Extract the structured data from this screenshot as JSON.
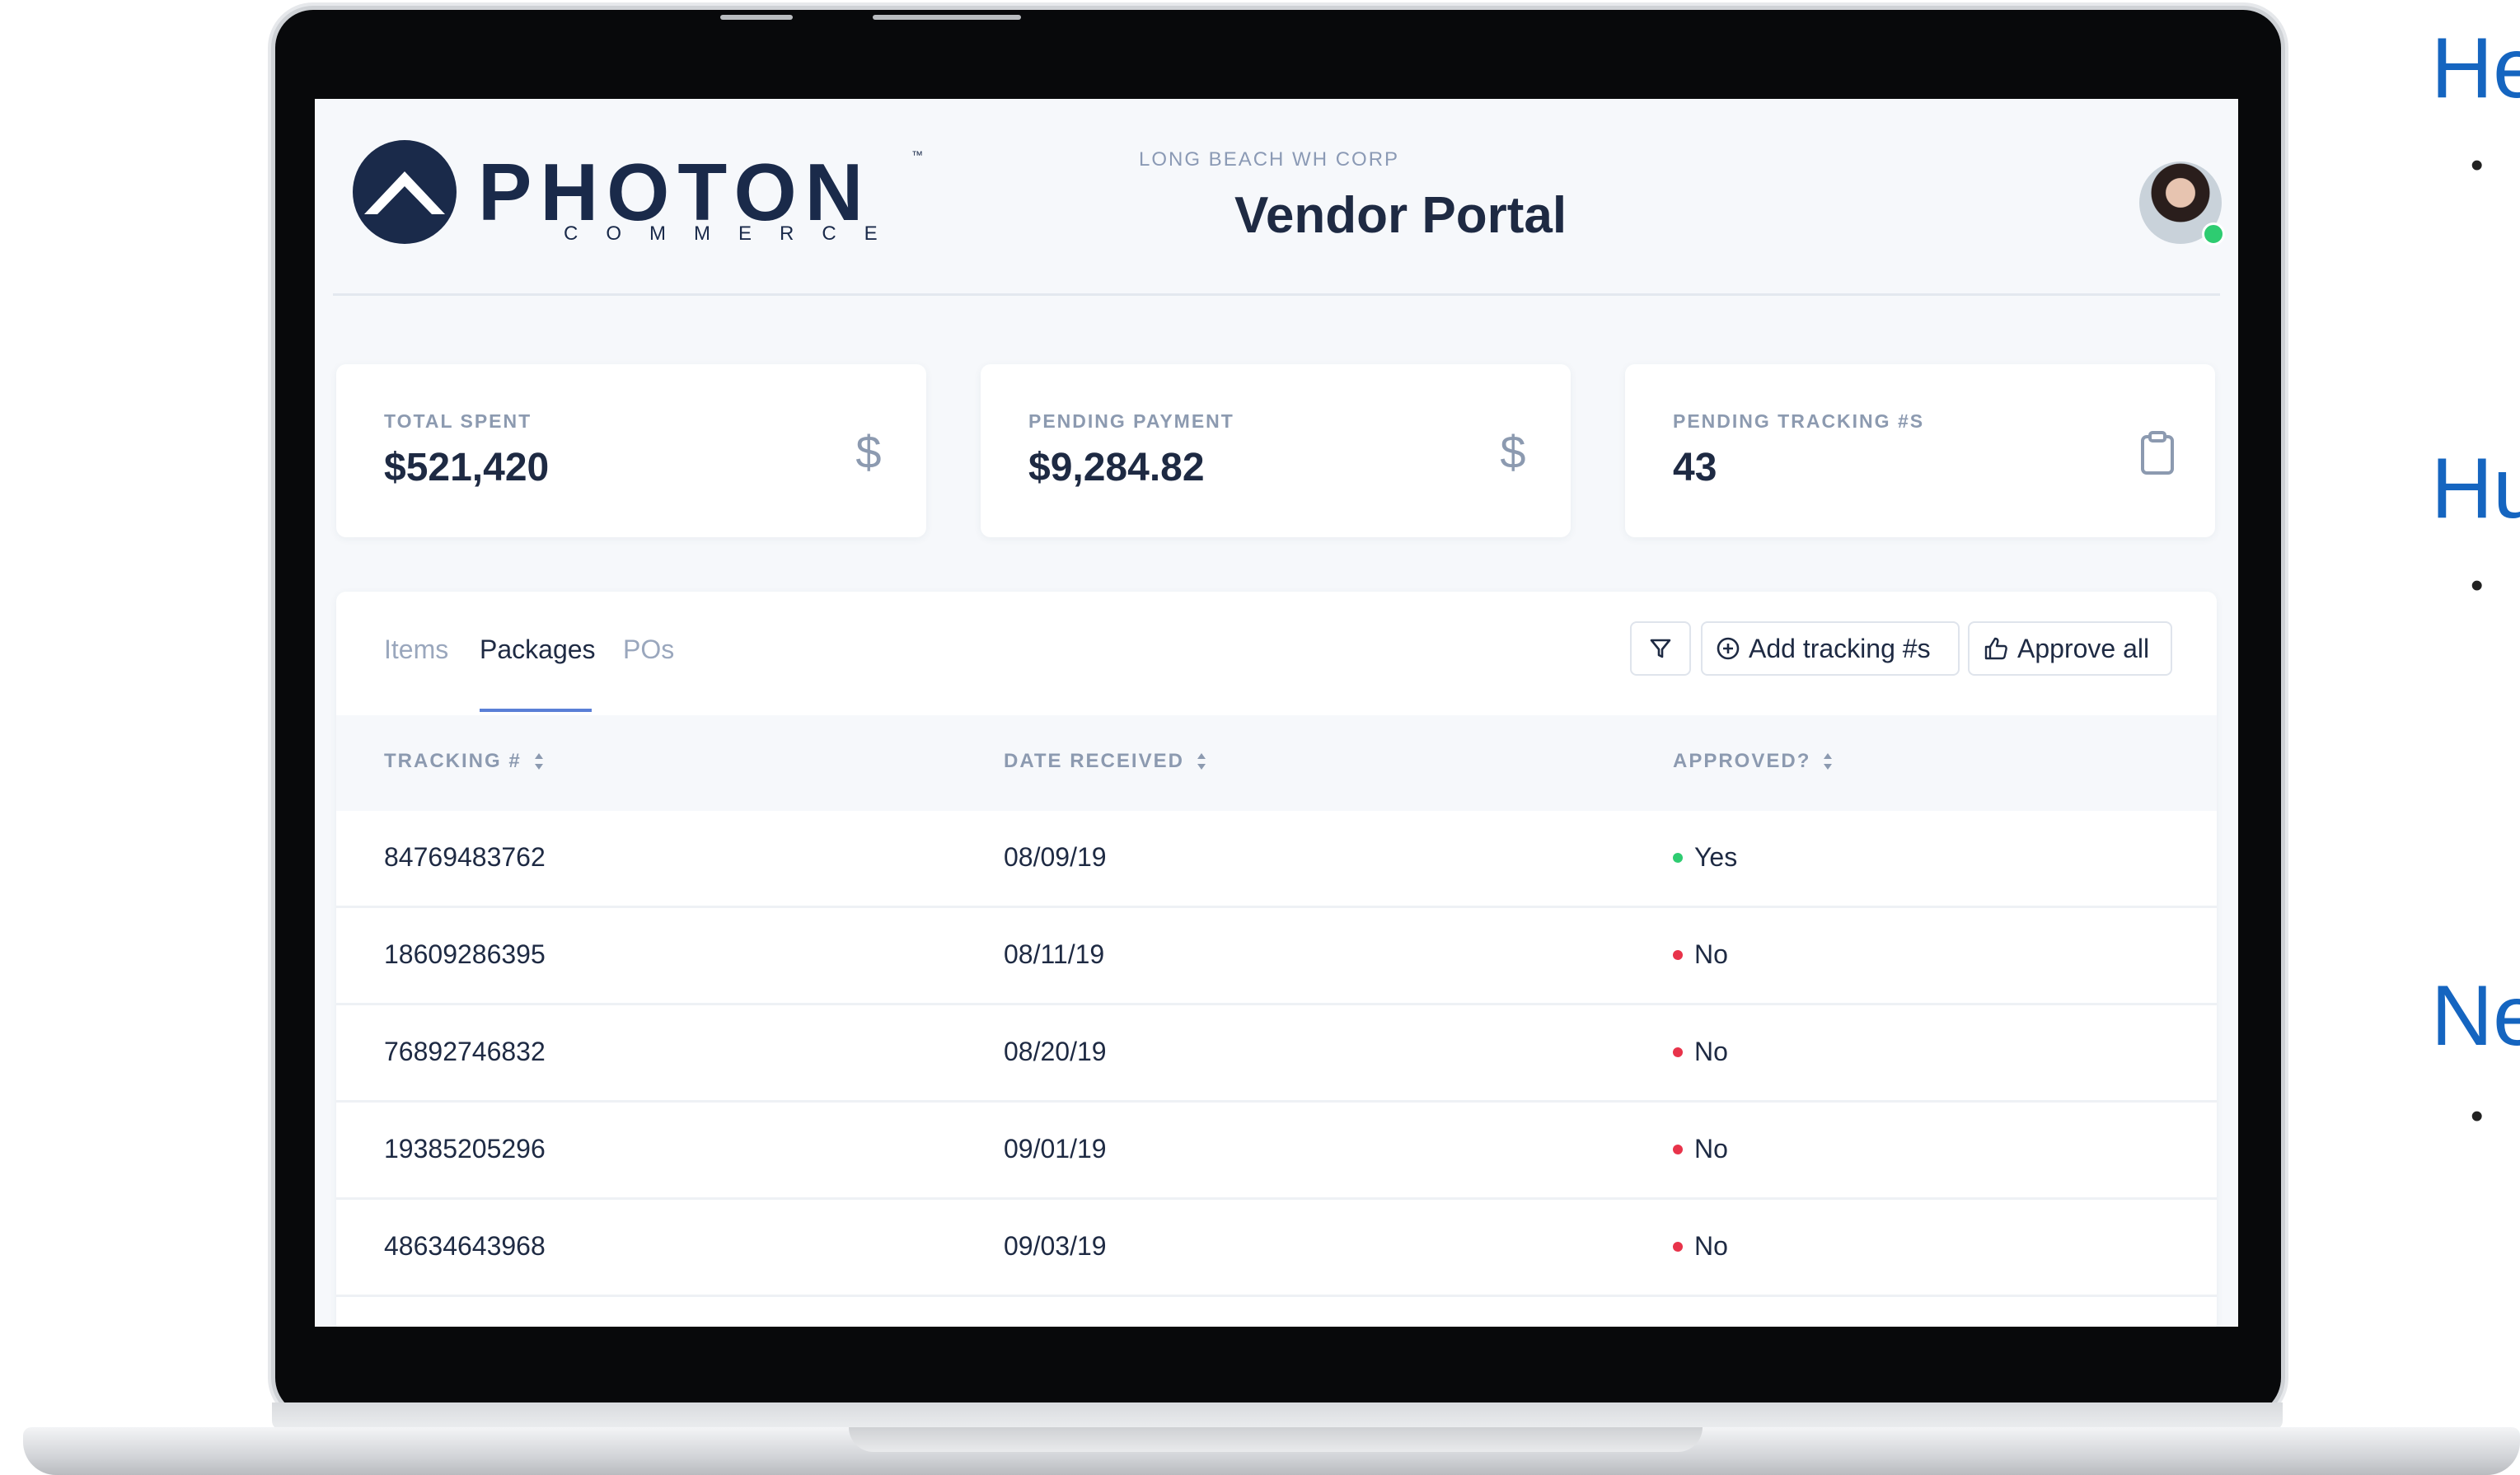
{
  "header": {
    "logo_word": "PHOTON",
    "logo_tm": "™",
    "logo_sub": "COMMERCE",
    "org_name": "LONG BEACH WH CORP",
    "title": "Vendor Portal"
  },
  "stats": [
    {
      "label": "TOTAL SPENT",
      "value": "$521,420",
      "icon": "dollar-icon"
    },
    {
      "label": "PENDING PAYMENT",
      "value": "$9,284.82",
      "icon": "dollar-icon"
    },
    {
      "label": "PENDING TRACKING #S",
      "value": "43",
      "icon": "clipboard-icon"
    }
  ],
  "tabs": [
    {
      "label": "Items",
      "active": false
    },
    {
      "label": "Packages",
      "active": true
    },
    {
      "label": "POs",
      "active": false
    }
  ],
  "toolbar": {
    "filter_icon": "filter-icon",
    "add_tracking_label": "Add tracking #s",
    "approve_all_label": "Approve all"
  },
  "table": {
    "columns": [
      "TRACKING #",
      "DATE RECEIVED",
      "APPROVED?"
    ],
    "rows": [
      {
        "tracking": "84769483762",
        "date": "08/09/19",
        "approved": "Yes"
      },
      {
        "tracking": "18609286395",
        "date": "08/11/19",
        "approved": "No"
      },
      {
        "tracking": "76892746832",
        "date": "08/20/19",
        "approved": "No"
      },
      {
        "tracking": "19385205296",
        "date": "09/01/19",
        "approved": "No"
      },
      {
        "tracking": "48634643968",
        "date": "09/03/19",
        "approved": "No"
      }
    ]
  },
  "colors": {
    "approved_yes": "#2ecc71",
    "approved_no": "#e8334a",
    "accent": "#5a7fd6",
    "side_heading": "#1565c0"
  },
  "side_text": {
    "headings": [
      "He",
      "Hu",
      "Ne"
    ],
    "bullet": "•"
  }
}
